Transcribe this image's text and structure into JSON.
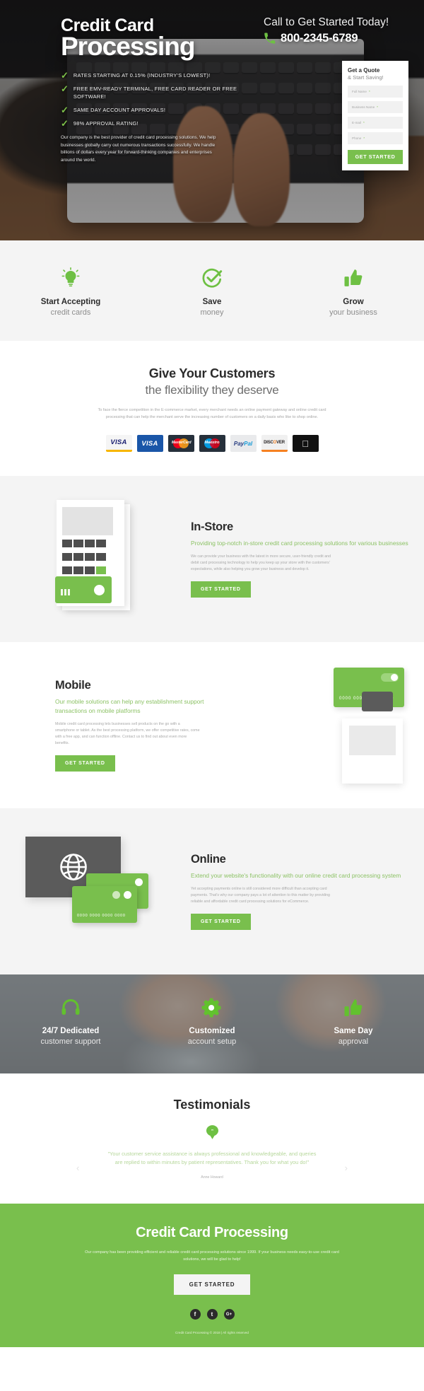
{
  "hero": {
    "title_line1": "Credit Card",
    "title_line2": "Processing",
    "bullets": [
      "RATES STARTING AT 0.15% (INDUSTRY'S LOWEST)!",
      "FREE EMV-READY TERMINAL, FREE CARD READER OR FREE SOFTWARE!",
      "SAME DAY ACCOUNT APPROVALS!",
      "98% APPROVAL RATING!"
    ],
    "paragraph": "Our company is the best provider of credit card processing solutions. We help businesses globally carry out numerous transactions successfully. We handle billions of dollars every year for forward-thinking companies and enterprises around the world.",
    "call_label": "Call to Get Started Today!",
    "phone": "800-2345-6789",
    "phone_icon": "phone-icon"
  },
  "quote_form": {
    "title": "Get a Quote",
    "subtitle": "& Start Saving!",
    "fields": [
      {
        "label": "Full Name",
        "required": "*",
        "value": ""
      },
      {
        "label": "Business Name",
        "required": "*",
        "value": ""
      },
      {
        "label": "E-mail",
        "required": "*",
        "value": ""
      },
      {
        "label": "Phone",
        "required": "*",
        "value": ""
      }
    ],
    "submit_label": "GET STARTED"
  },
  "benefits": [
    {
      "icon": "lightbulb-icon",
      "title": "Start Accepting",
      "subtitle": "credit cards"
    },
    {
      "icon": "check-circle-icon",
      "title": "Save",
      "subtitle": "money"
    },
    {
      "icon": "thumbs-up-icon",
      "title": "Grow",
      "subtitle": "your business"
    }
  ],
  "customers": {
    "heading_bold": "Give Your Customers",
    "heading_light": "the flexibility they deserve",
    "paragraph": "To face the fierce competition in the E-commerce market, every merchant needs an online payment gateway and online credit card processing that can help the merchant serve the increasing number of customers on a daily basis who like to shop online.",
    "logos": [
      "VISA",
      "VISA",
      "MasterCard",
      "Maestro",
      "PayPal",
      "DISCOVER",
      "Apple Pay"
    ]
  },
  "sections": [
    {
      "key": "instore",
      "heading": "In-Store",
      "subheading": "Providing top-notch in-store credit card processing solutions for various businesses",
      "paragraph": "We can provide your business with the latest in more secure, user-friendly credit and debit card processing technology to help you keep up your store with the customers' expectations, while also helping you grow your business and develop it.",
      "button": "GET STARTED"
    },
    {
      "key": "mobile",
      "heading": "Mobile",
      "subheading": "Our mobile solutions can help any establishment support transactions on mobile platforms",
      "paragraph": "Mobile credit card processing lets businesses sell products on the go with a smartphone or tablet. As the best processing platform, we offer competitive rates, come with a free app, and can function offline. Contact us to find out about even more benefits.",
      "button": "GET STARTED"
    },
    {
      "key": "online",
      "heading": "Online",
      "subheading": "Extend your website's functionality with our online credit card processing system",
      "paragraph": "Yet accepting payments online is still considered more difficult than accepting card payments. That's why our company pays a lot of attention to this matter by providing reliable and affordable credit card processing solutions for eCommerce.",
      "button": "GET STARTED"
    }
  ],
  "services_band": [
    {
      "icon": "headset-icon",
      "title": "24/7 Dedicated",
      "subtitle": "customer support"
    },
    {
      "icon": "gear-icon",
      "title": "Customized",
      "subtitle": "account setup"
    },
    {
      "icon": "thumbs-up-icon",
      "title": "Same Day",
      "subtitle": "approval"
    }
  ],
  "testimonials": {
    "heading": "Testimonials",
    "badge_icon": "quote-bubble-icon",
    "quote": "\"Your customer service assistance is always professional and knowledgeable, and queries are replied to within minutes by patient representatives. Thank you for what you do!\"",
    "author": "Anne Howard",
    "prev_icon": "chevron-left-icon",
    "next_icon": "chevron-right-icon"
  },
  "cta": {
    "heading": "Credit Card Processing",
    "paragraph": "Our company has been providing efficient and reliable credit card processing solutions since 1999. If your business needs easy-to-use credit card solutions, we will be glad to help!",
    "button": "GET STARTED",
    "socials": [
      "f",
      "t",
      "G+"
    ],
    "copyright": "Credit Card Processing © 2018 | All rights reserved"
  },
  "colors": {
    "green": "#79bf4d",
    "green_light": "#8cc265",
    "dark": "#2b2b2b",
    "grey_bg": "#f4f4f4"
  }
}
